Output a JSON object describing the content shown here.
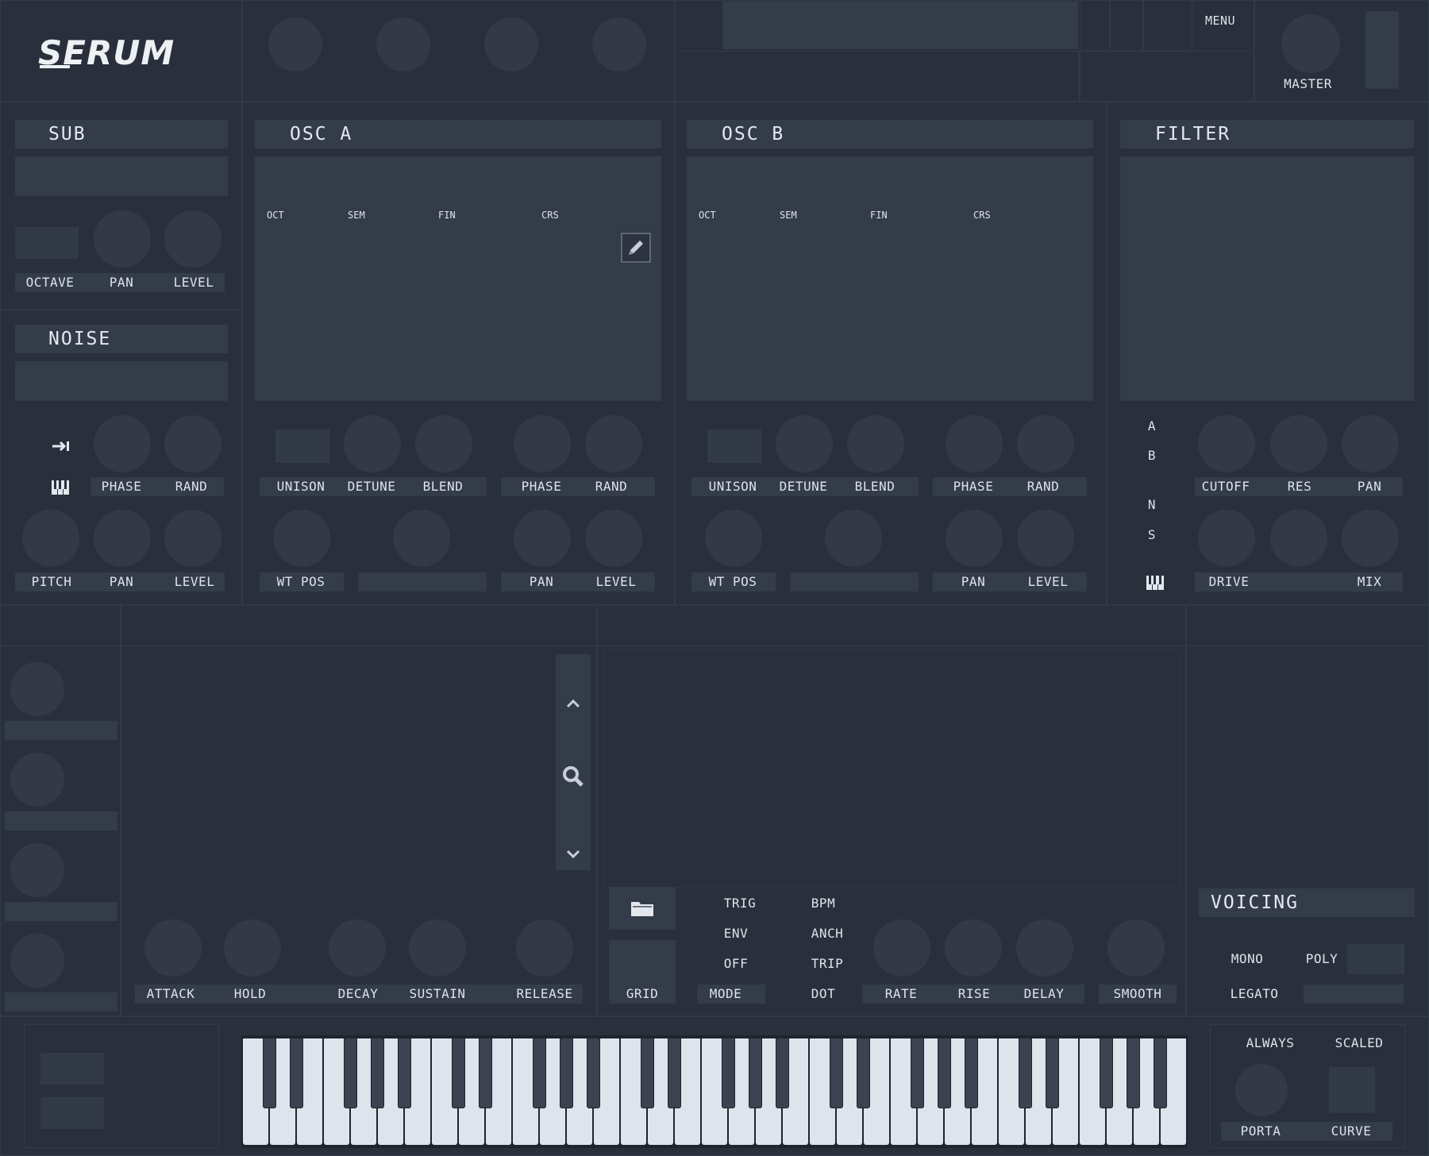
{
  "header": {
    "logo": "SERUM",
    "menu_label": "MENU",
    "master_label": "MASTER"
  },
  "sub": {
    "title": "SUB",
    "labels": [
      "OCTAVE",
      "PAN",
      "LEVEL"
    ]
  },
  "noise": {
    "title": "NOISE",
    "row1_labels": [
      "PHASE",
      "RAND"
    ],
    "row2_labels": [
      "PITCH",
      "PAN",
      "LEVEL"
    ]
  },
  "osc_a": {
    "title": "OSC A",
    "tuning": [
      "OCT",
      "SEM",
      "FIN",
      "CRS"
    ],
    "row1_labels": [
      "UNISON",
      "DETUNE",
      "BLEND",
      "PHASE",
      "RAND"
    ],
    "row2_labels": [
      "WT POS",
      "PAN",
      "LEVEL"
    ]
  },
  "osc_b": {
    "title": "OSC B",
    "tuning": [
      "OCT",
      "SEM",
      "FIN",
      "CRS"
    ],
    "row1_labels": [
      "UNISON",
      "DETUNE",
      "BLEND",
      "PHASE",
      "RAND"
    ],
    "row2_labels": [
      "WT POS",
      "PAN",
      "LEVEL"
    ]
  },
  "filter": {
    "title": "FILTER",
    "routing": [
      "A",
      "B",
      "N",
      "S"
    ],
    "row1_labels": [
      "CUTOFF",
      "RES",
      "PAN"
    ],
    "row2_labels": [
      "DRIVE",
      "MIX"
    ]
  },
  "envelope": {
    "labels": [
      "ATTACK",
      "HOLD",
      "DECAY",
      "SUSTAIN",
      "RELEASE"
    ]
  },
  "lfo": {
    "grid_label": "GRID",
    "trig_options": [
      "TRIG",
      "ENV",
      "OFF"
    ],
    "mode_label": "MODE",
    "bpm_options": [
      "BPM",
      "ANCH",
      "TRIP",
      "DOT"
    ],
    "knob_labels": [
      "RATE",
      "RISE",
      "DELAY",
      "SMOOTH"
    ]
  },
  "voicing": {
    "title": "VOICING",
    "mono": "MONO",
    "poly": "POLY",
    "legato": "LEGATO"
  },
  "porta": {
    "always": "ALWAYS",
    "scaled": "SCALED",
    "porta": "PORTA",
    "curve": "CURVE"
  },
  "icons": {
    "pencil": "pencil-icon",
    "search": "search-icon",
    "folder": "folder-icon",
    "arrow_up": "chevron-up-icon",
    "arrow_down": "chevron-down-icon",
    "keyboard": "piano-keys-icon",
    "route": "arrow-to-bar-icon"
  },
  "colors": {
    "background": "#29303c",
    "panel_bar": "#343c49",
    "knob": "#333a46",
    "text": "#dfe3ea",
    "white_key": "#dfe3ec",
    "black_key": "#3b4250"
  }
}
